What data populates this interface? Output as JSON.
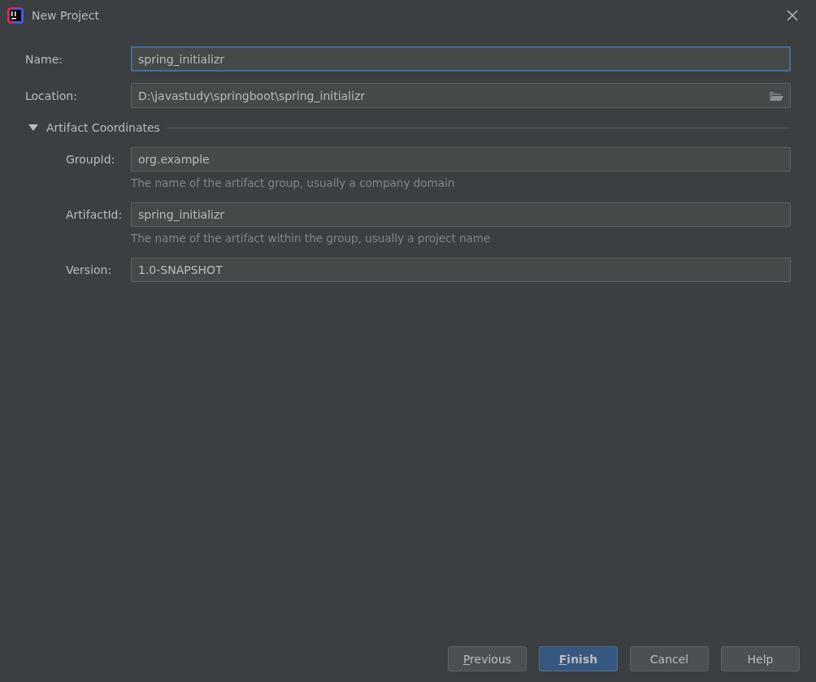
{
  "window": {
    "title": "New Project"
  },
  "fields": [
    {
      "label": "Name:",
      "value": "spring_initializr",
      "focused": true,
      "browse": false
    },
    {
      "label": "Location:",
      "value": "D:\\javastudy\\springboot\\spring_initializr",
      "focused": false,
      "browse": true
    }
  ],
  "section": {
    "title": "Artifact Coordinates",
    "expanded": true,
    "fields": [
      {
        "label": "GroupId:",
        "value": "org.example",
        "hint": "The name of the artifact group, usually a company domain"
      },
      {
        "label": "ArtifactId:",
        "value": "spring_initializr",
        "hint": "The name of the artifact within the group, usually a project name"
      },
      {
        "label": "Version:",
        "value": "1.0-SNAPSHOT"
      }
    ]
  },
  "buttons": [
    {
      "label": "Previous",
      "default": false,
      "mnemonic": true
    },
    {
      "label": "Finish",
      "default": true,
      "mnemonic": true
    },
    {
      "label": "Cancel",
      "default": false,
      "mnemonic": false
    },
    {
      "label": "Help",
      "default": false,
      "mnemonic": false
    }
  ]
}
